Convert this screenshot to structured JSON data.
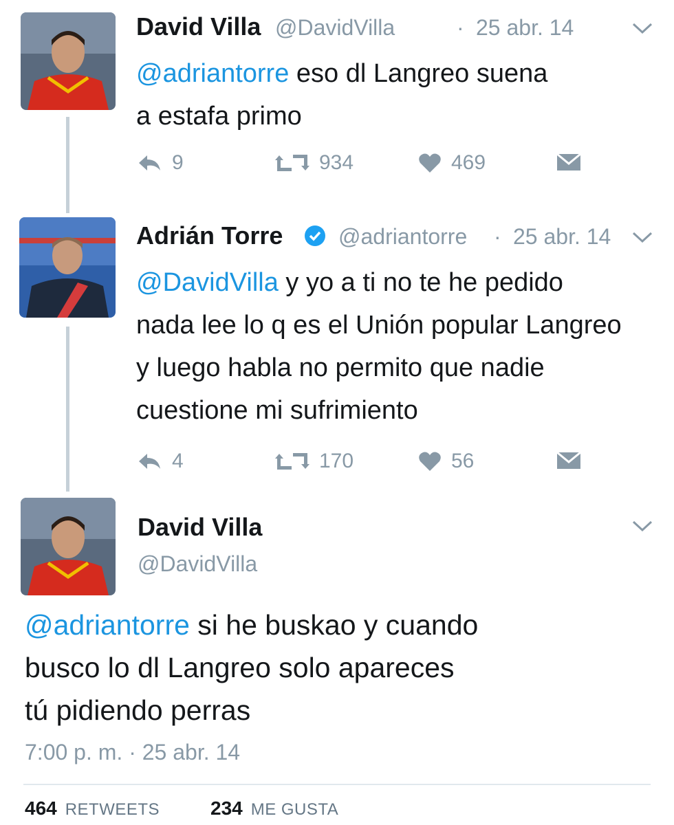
{
  "tweets": [
    {
      "name": "David Villa",
      "handle": "@DavidVilla",
      "dot": "·",
      "date": "25 abr. 14",
      "mention": "@adriantorre",
      "text_line1": " eso dl Langreo suena",
      "text_line2": "a estafa primo",
      "replies": "9",
      "retweets": "934",
      "likes": "469"
    },
    {
      "name": "Adrián Torre",
      "handle": "@adriantorre",
      "dot": "·",
      "date": "25 abr. 14",
      "mention": "@DavidVilla",
      "text_line1": " y yo a ti no te he pedido",
      "text_line2": "nada lee lo q es el Unión popular Langreo",
      "text_line3": "y luego habla no permito que nadie",
      "text_line4": "cuestione mi sufrimiento",
      "replies": "4",
      "retweets": "170",
      "likes": "56"
    }
  ],
  "main_tweet": {
    "name": "David Villa",
    "handle": "@DavidVilla",
    "mention": "@adriantorre",
    "text_line1": " si he buskao y cuando",
    "text_line2": "busco lo dl Langreo solo apareces",
    "text_line3": "tú pidiendo perras",
    "timestamp": "7:00 p. m. · 25 abr. 14",
    "retweets_count": "464",
    "retweets_label": "RETWEETS",
    "likes_count": "234",
    "likes_label": "ME GUSTA"
  },
  "icons": {
    "reply": "reply-icon",
    "retweet": "retweet-icon",
    "like": "heart-icon",
    "dm": "envelope-icon",
    "more": "chevron-down-icon",
    "verified": "verified-badge-icon"
  },
  "colors": {
    "mention": "#1b95e0",
    "secondary": "#8899a6",
    "thread_line": "#c6d0d8",
    "verified": "#1da1f2"
  }
}
